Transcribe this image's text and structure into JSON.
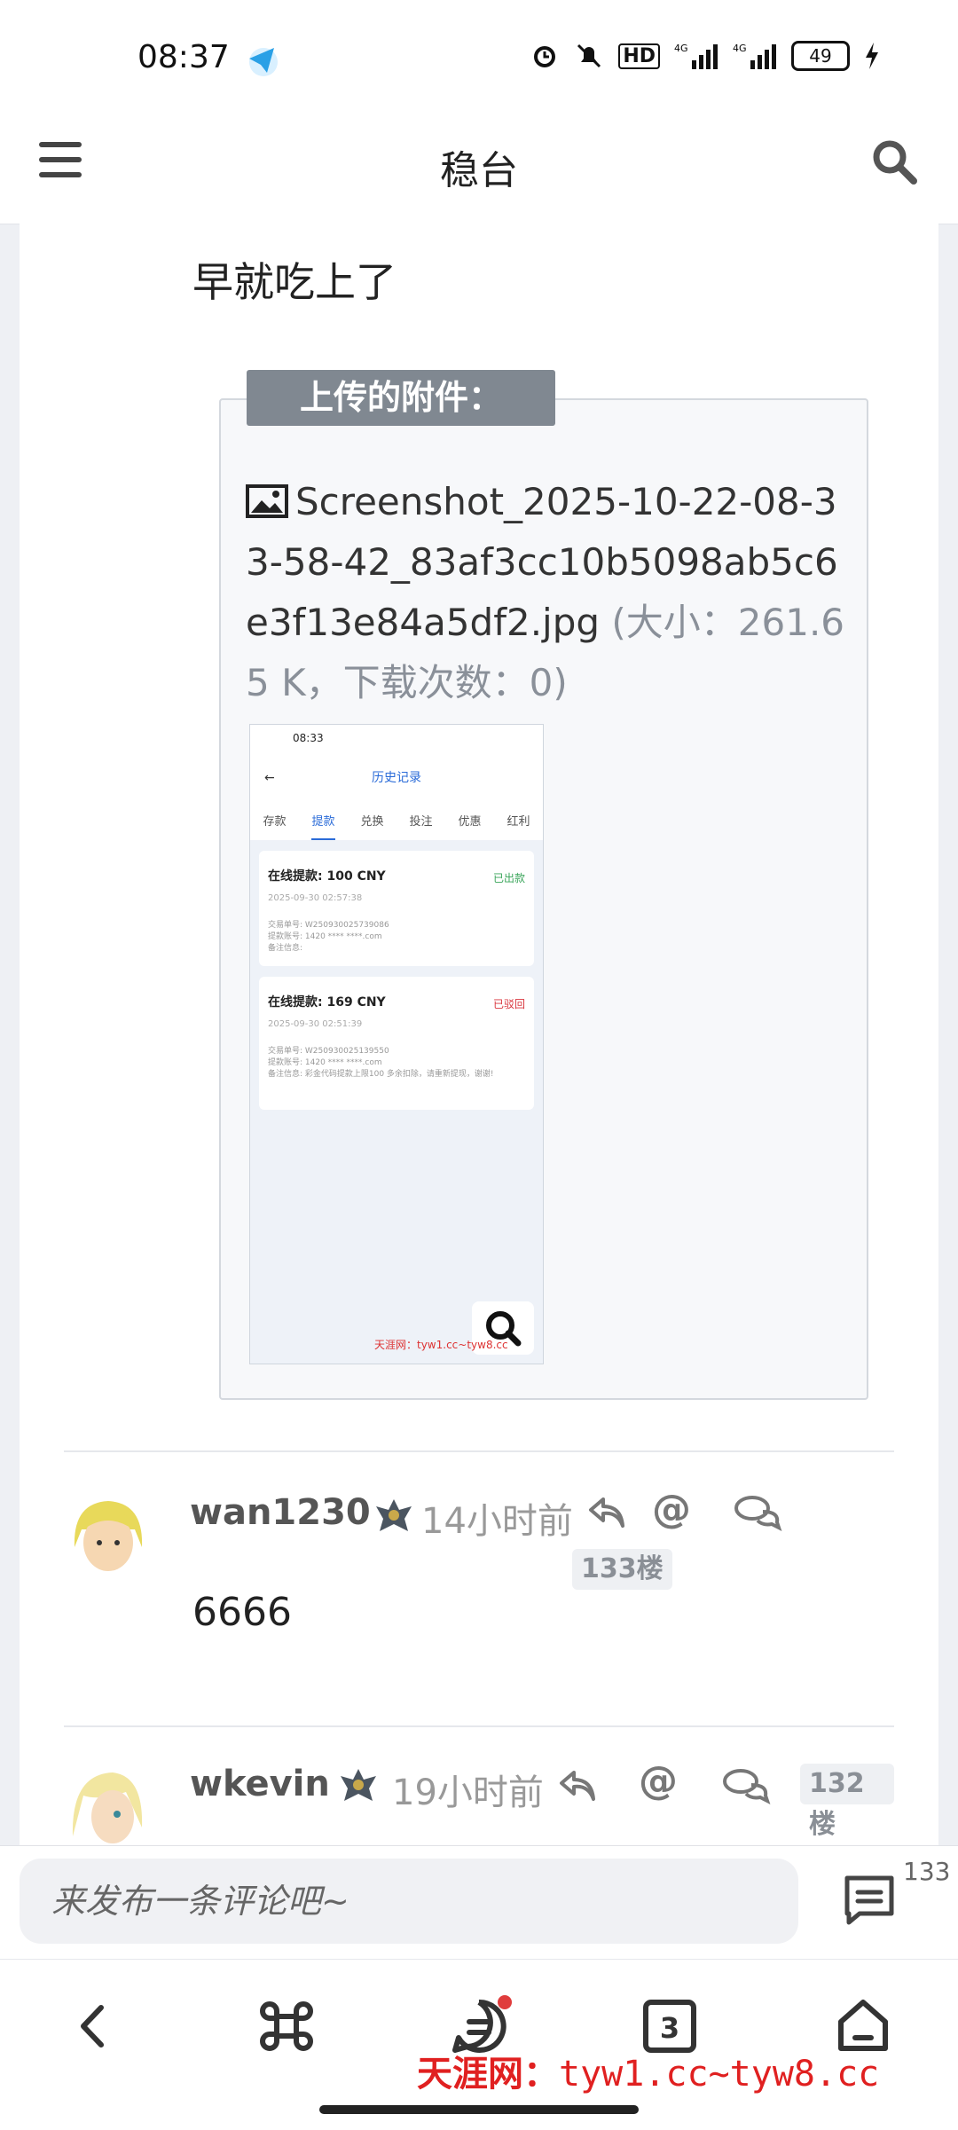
{
  "status_bar": {
    "time": "08:37",
    "battery": "49"
  },
  "header": {
    "title": "稳台"
  },
  "post": {
    "text": "早就吃上了",
    "attachment_label": "上传的附件：",
    "file_name": "Screenshot_2025-10-22-08-33-58-42_83af3cc10b5098ab5c6e3f13e84a5df2.jpg",
    "file_meta": "(大小：261.65 K，下载次数：0)",
    "thumbnail": {
      "time": "08:33",
      "title": "历史记录",
      "tabs": [
        "存款",
        "提款",
        "兑换",
        "投注",
        "优惠",
        "红利"
      ],
      "active_tab": "提款",
      "records": [
        {
          "title": "在线提款: 100 CNY",
          "status": "已出款",
          "status_color": "#3aa55a",
          "date": "2025-09-30 02:57:38",
          "lines": [
            "交易单号: W250930025739086",
            "提款账号: 1420 **** ****.com",
            "备注信息:"
          ]
        },
        {
          "title": "在线提款: 169 CNY",
          "status": "已驳回",
          "status_color": "#d9363e",
          "date": "2025-09-30 02:51:39",
          "lines": [
            "交易单号: W250930025139550",
            "提款账号: 1420 **** ****.com",
            "备注信息: 彩金代码提款上限100 多余扣除，请重新提现，谢谢!"
          ]
        }
      ],
      "watermark": "天涯网：tyw1.cc~tyw8.cc"
    }
  },
  "comments": [
    {
      "user": "wan1230",
      "time": "14小时前",
      "floor": "133楼",
      "body": "6666"
    },
    {
      "user": "wkevin",
      "time": "19小时前",
      "floor": "132楼",
      "body": ""
    }
  ],
  "comment_bar": {
    "placeholder": "来发布一条评论吧~",
    "count": "133"
  },
  "watermark": {
    "brand": "天涯网：",
    "url": "tyw1.cc~tyw8.cc"
  },
  "icons": {
    "menu": "menu-icon",
    "search": "search-icon",
    "image": "image-icon",
    "reply": "reply-icon",
    "at": "at-icon",
    "chat": "chat-icon",
    "back": "back-icon",
    "apps": "command-icon",
    "messages": "message-icon",
    "tabs": "tabs-icon",
    "home": "home-icon"
  },
  "colors": {
    "accent_blue": "#2a6bd8",
    "tag_grey": "#808891",
    "watermark_red": "#e02020"
  }
}
